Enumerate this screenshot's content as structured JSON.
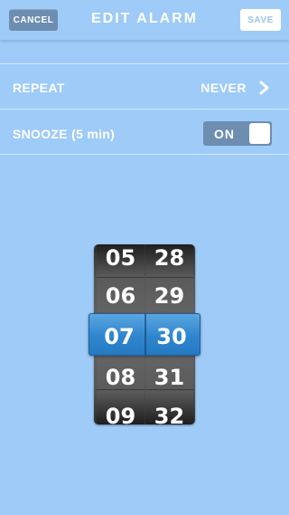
{
  "header": {
    "cancel_label": "CANCEL",
    "title": "EDIT ALARM",
    "save_label": "SAVE"
  },
  "settings": {
    "repeat": {
      "label": "REPEAT",
      "value": "NEVER",
      "icon": "chevron-right-icon"
    },
    "snooze": {
      "label": "SNOOZE (5 min)",
      "toggle_label": "ON",
      "toggle_on": true
    }
  },
  "time_picker": {
    "hours": [
      "05",
      "06",
      "07",
      "08",
      "09"
    ],
    "minutes": [
      "28",
      "29",
      "30",
      "31",
      "32"
    ],
    "selected_hour": "07",
    "selected_minute": "30"
  },
  "colors": {
    "background": "#9ecbf8",
    "button_dark": "#6d8eb0",
    "selection_blue": "#2f86cf"
  }
}
